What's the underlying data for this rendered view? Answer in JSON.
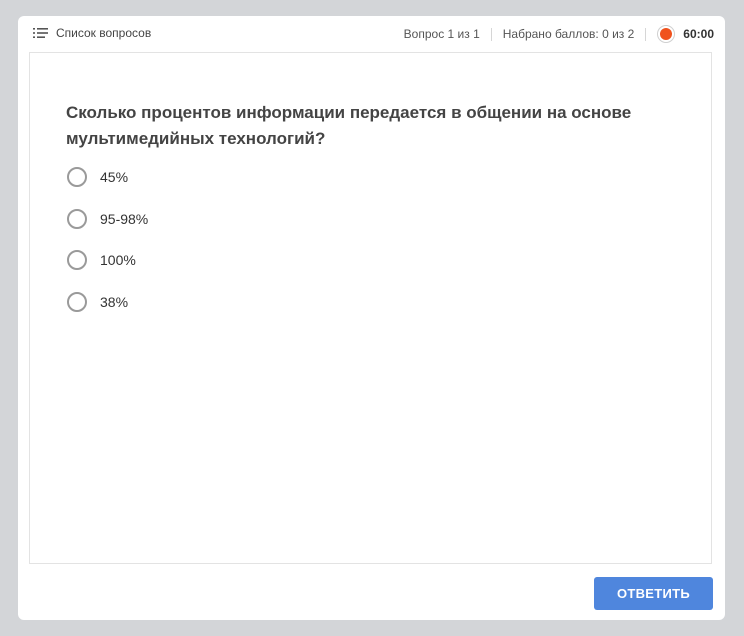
{
  "header": {
    "question_list_label": "Список вопросов",
    "question_counter": "Вопрос 1 из 1",
    "score": "Набрано баллов: 0 из 2",
    "timer": "60:00"
  },
  "question": {
    "text": "Сколько процентов информации передается в общении на основе мультимедийных технологий?",
    "options": [
      {
        "label": "45%",
        "selected": false
      },
      {
        "label": "95-98%",
        "selected": false
      },
      {
        "label": "100%",
        "selected": false
      },
      {
        "label": "38%",
        "selected": false
      }
    ]
  },
  "actions": {
    "answer_label": "ОТВЕТИТЬ"
  },
  "colors": {
    "accent": "#4f86dd",
    "timer_indicator": "#f0521d",
    "background": "#d3d5d8"
  }
}
